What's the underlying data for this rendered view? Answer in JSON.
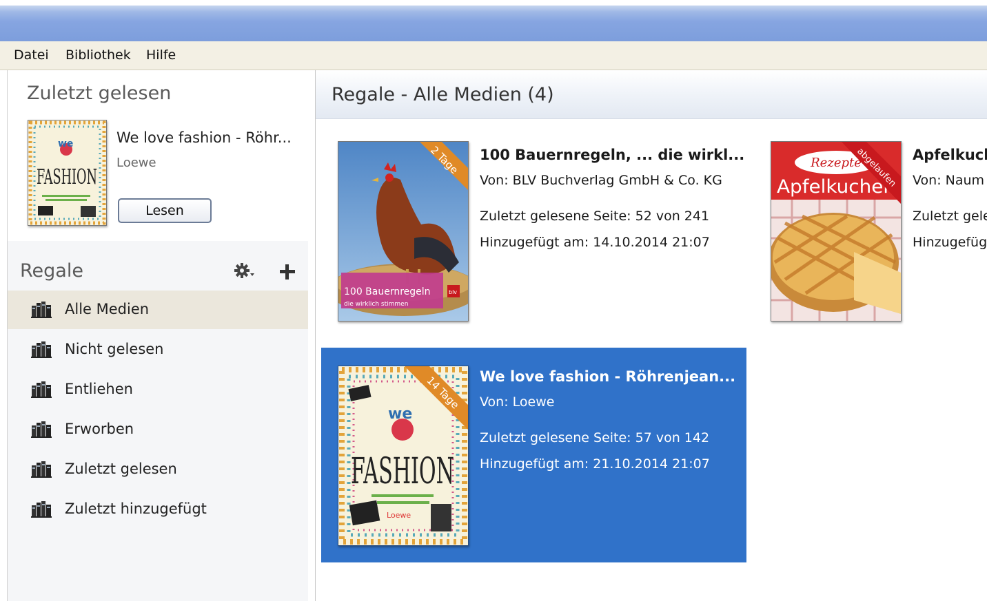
{
  "menu": {
    "items": [
      "Datei",
      "Bibliothek",
      "Hilfe"
    ]
  },
  "sidebar": {
    "recent": {
      "title": "Zuletzt gelesen",
      "book_title": "We love fashion - Röhr...",
      "author": "Loewe",
      "read_button": "Lesen"
    },
    "shelves": {
      "title": "Regale",
      "items": [
        {
          "label": "Alle Medien",
          "active": true
        },
        {
          "label": "Nicht gelesen"
        },
        {
          "label": "Entliehen"
        },
        {
          "label": "Erworben"
        },
        {
          "label": "Zuletzt gelesen"
        },
        {
          "label": "Zuletzt hinzugefügt"
        }
      ]
    }
  },
  "main": {
    "title": "Regale - Alle Medien (4)",
    "books": [
      {
        "title": "100 Bauernregeln, ... die wirkl...",
        "by": "Von:  BLV Buchverlag GmbH & Co. KG",
        "last_page": "Zuletzt gelesene Seite:  52 von 241",
        "added": "Hinzugefügt am:  14.10.2014 21:07",
        "ribbon": "2 Tage",
        "cover_text": "100 Bauernregeln",
        "cover_sub": "die wirklich stimmen",
        "publisher_mark": "blv"
      },
      {
        "title": "Apfelkuch",
        "by": "Von:  Naum",
        "last_page": "Zuletzt gele",
        "added": "Hinzugefüg",
        "ribbon": "abgelaufen",
        "cover_text": "Apfelkuchen",
        "cover_brand": "Rezepte"
      },
      {
        "title": "We love fashion - Röhrenjean...",
        "by": "Von:  Loewe",
        "last_page": "Zuletzt gelesene Seite:  57 von 142",
        "added": "Hinzugefügt am:  21.10.2014 21:07",
        "ribbon": "14 Tage",
        "cover_text": "FASHION",
        "cover_top": "we",
        "cover_publisher": "Loewe"
      }
    ]
  },
  "colors": {
    "selection": "#3072c9",
    "ribbon_orange": "#e08a27",
    "ribbon_red": "#c8191e",
    "titlebar": "#86a5e1"
  },
  "icons": [
    "gear-icon",
    "plus-icon",
    "bookshelf-icon"
  ]
}
